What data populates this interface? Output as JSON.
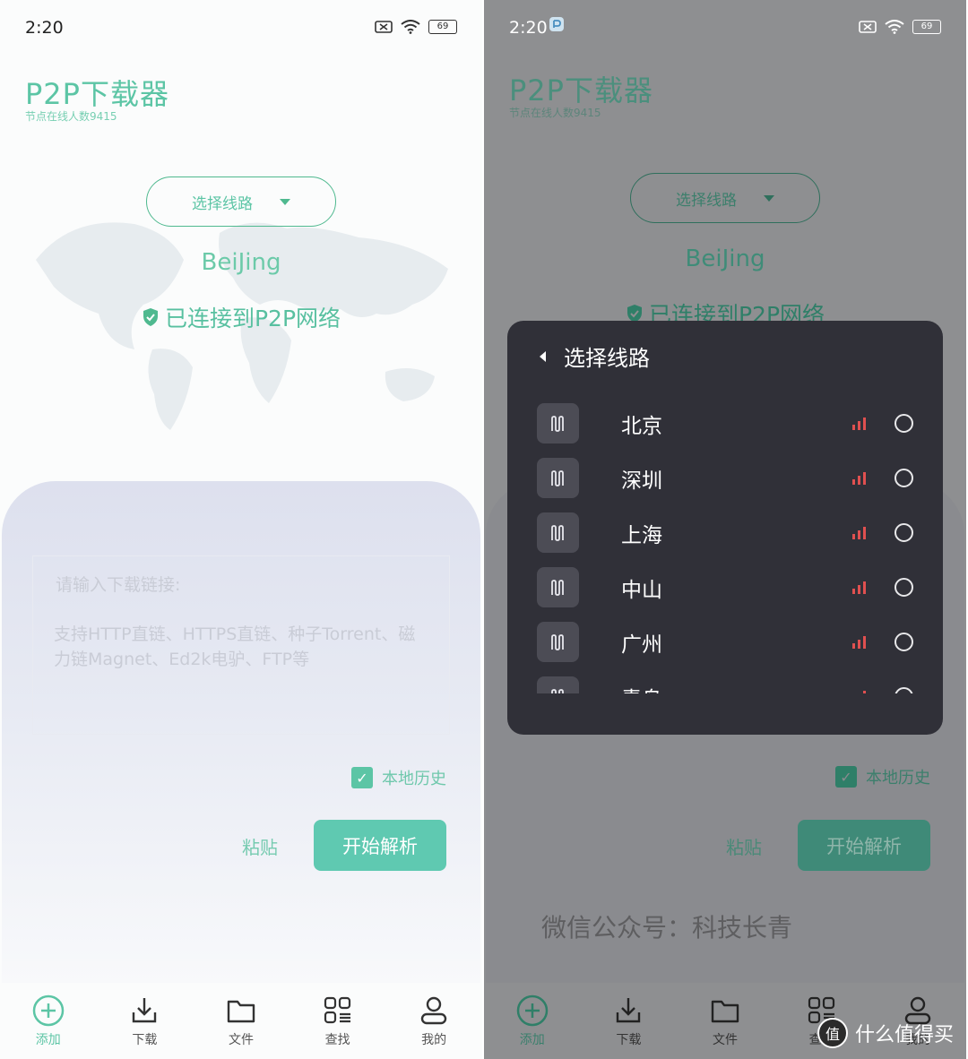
{
  "status": {
    "time": "2:20",
    "battery": "69"
  },
  "app": {
    "title": "P2P下载器",
    "subtitle": "节点在线人数9415"
  },
  "route": {
    "select_label": "选择线路",
    "city": "BeiJing",
    "connected": "已连接到P2P网络"
  },
  "download": {
    "input_label": "请输入下载链接:",
    "placeholder": "支持HTTP直链、HTTPS直链、种子Torrent、磁力链Magnet、Ed2k电驴、FTP等",
    "history_label": "本地历史",
    "history_checked": true,
    "paste_label": "粘贴",
    "parse_label": "开始解析"
  },
  "nav": [
    {
      "label": "添加",
      "icon": "add-circle-icon",
      "active": true
    },
    {
      "label": "下载",
      "icon": "download-icon",
      "active": false
    },
    {
      "label": "文件",
      "icon": "folder-icon",
      "active": false
    },
    {
      "label": "查找",
      "icon": "grid-search-icon",
      "active": false
    },
    {
      "label": "我的",
      "icon": "user-icon",
      "active": false
    }
  ],
  "modal": {
    "title": "选择线路",
    "routes": [
      {
        "name": "北京"
      },
      {
        "name": "深圳"
      },
      {
        "name": "上海"
      },
      {
        "name": "中山"
      },
      {
        "name": "广州"
      },
      {
        "name": "青岛"
      }
    ]
  },
  "watermark": "微信公众号：科技长青",
  "credit": {
    "logo": "值",
    "text": "什么值得买"
  },
  "colors": {
    "accent": "#5cc5a5",
    "button": "#5fc9b1",
    "modal_bg": "#303038",
    "signal": "#e05050"
  }
}
